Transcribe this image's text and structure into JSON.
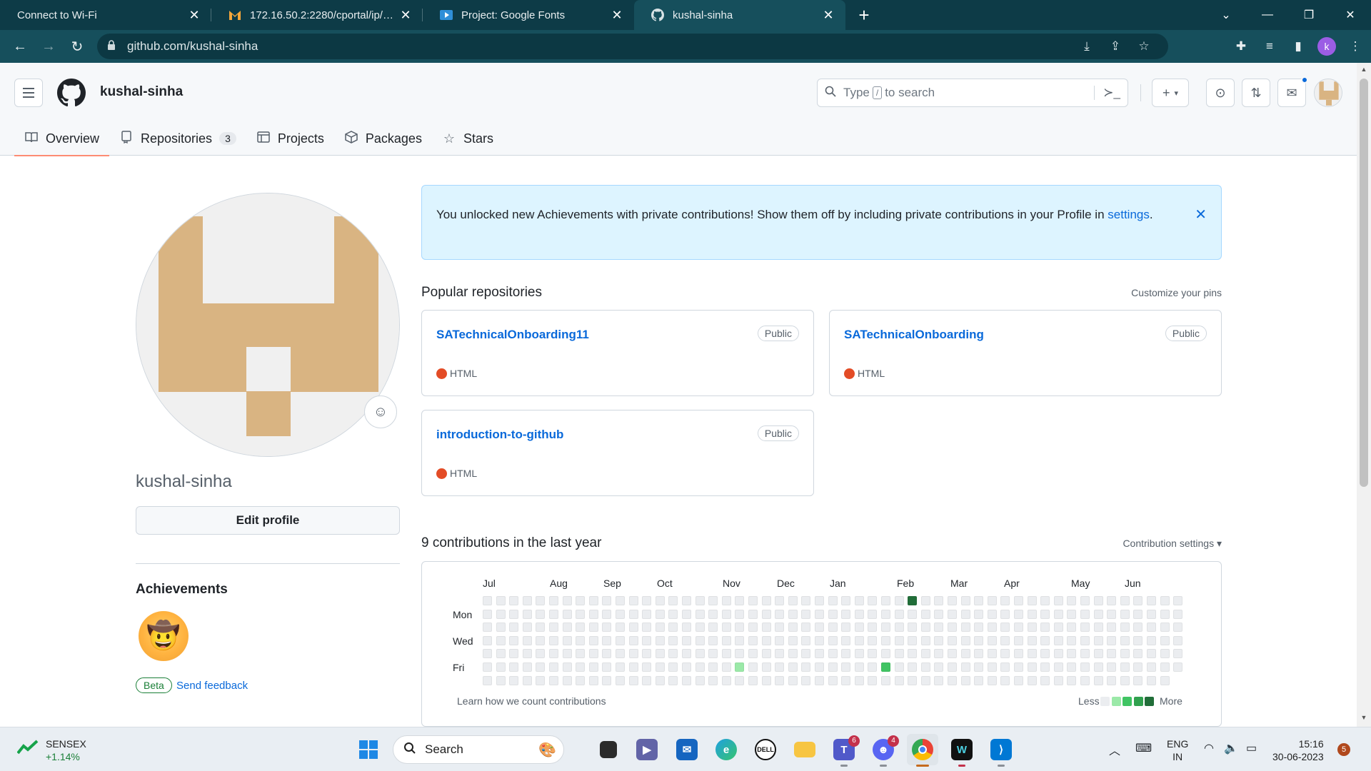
{
  "browser": {
    "tabs": [
      {
        "title": "Connect to Wi-Fi",
        "icon": "none",
        "active": false
      },
      {
        "title": "172.16.50.2:2280/cportal/ip/user_",
        "icon": "gmail-like-icon",
        "active": false
      },
      {
        "title": "Project: Google Fonts",
        "icon": "play-icon",
        "active": false
      },
      {
        "title": "kushal-sinha",
        "icon": "github-icon",
        "active": true
      }
    ],
    "url": "github.com/kushal-sinha",
    "profile_initial": "k"
  },
  "github": {
    "username": "kushal-sinha",
    "search_placeholder_prefix": "Type",
    "search_key": "/",
    "search_placeholder_suffix": "to search",
    "tabs": [
      {
        "label": "Overview",
        "icon": "book-icon",
        "selected": true
      },
      {
        "label": "Repositories",
        "icon": "repo-icon",
        "count": "3"
      },
      {
        "label": "Projects",
        "icon": "table-icon"
      },
      {
        "label": "Packages",
        "icon": "package-icon"
      },
      {
        "label": "Stars",
        "icon": "star-icon"
      }
    ]
  },
  "profile": {
    "login": "kushal-sinha",
    "edit_label": "Edit profile",
    "achievements_title": "Achievements",
    "beta_label": "Beta",
    "feedback_label": "Send feedback"
  },
  "flash": {
    "text": "You unlocked new Achievements with private contributions! Show them off by including private contributions in your Profile in",
    "link": "settings",
    "tail": "."
  },
  "popular": {
    "title": "Popular repositories",
    "customize": "Customize your pins",
    "repos": [
      {
        "name": "SATechnicalOnboarding11",
        "visibility": "Public",
        "language": "HTML",
        "lang_color": "#e34c26"
      },
      {
        "name": "SATechnicalOnboarding",
        "visibility": "Public",
        "language": "HTML",
        "lang_color": "#e34c26"
      },
      {
        "name": "introduction-to-github",
        "visibility": "Public",
        "language": "HTML",
        "lang_color": "#e34c26"
      }
    ]
  },
  "contributions": {
    "title": "9 contributions in the last year",
    "settings": "Contribution settings",
    "months": [
      "Jul",
      "Aug",
      "Sep",
      "Oct",
      "Nov",
      "Dec",
      "Jan",
      "Feb",
      "Mar",
      "Apr",
      "May",
      "Jun"
    ],
    "days": [
      "Mon",
      "Wed",
      "Fri"
    ],
    "learn": "Learn how we count contributions",
    "less": "Less",
    "more": "More",
    "levels": [
      "#ebedf0",
      "#9be9a8",
      "#40c463",
      "#30a14e",
      "#216e39"
    ],
    "active_cells": [
      {
        "week": 32,
        "day": 0,
        "level": 4
      },
      {
        "week": 19,
        "day": 5,
        "level": 1
      },
      {
        "week": 30,
        "day": 5,
        "level": 2
      }
    ]
  },
  "taskbar": {
    "ticker_name": "SENSEX",
    "ticker_change": "+1.14%",
    "search_label": "Search",
    "lang_line1": "ENG",
    "lang_line2": "IN",
    "time": "15:16",
    "date": "30-06-2023",
    "notif_count": "5",
    "teams_badge": "6",
    "discord_badge": "4"
  }
}
